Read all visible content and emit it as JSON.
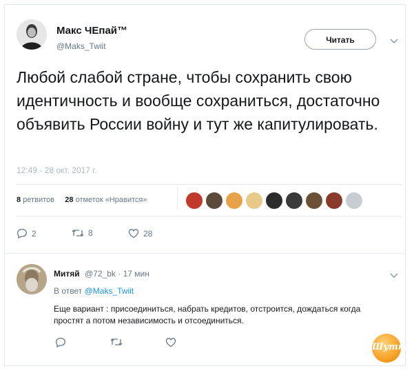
{
  "tweet": {
    "author_name": "Макс ЧЕпай™",
    "author_handle": "@Maks_Twiit",
    "follow_label": "Читать",
    "text": "Любой слабой стране, чтобы сохранить свою идентичность и вообще сохраниться, достаточно объявить России войну и тут же капитулировать.",
    "timestamp": "12:49 - 28 окт. 2017 г.",
    "retweets_count": "8",
    "retweets_label": "ретвитов",
    "likes_count": "28",
    "likes_label": "отметок «Нравится»",
    "likers": [
      "#c0392b",
      "#5b4a3a",
      "#e8a24a",
      "#e9c98a",
      "#2c2c2c",
      "#3a3a3a",
      "#6b5037",
      "#8a3a2c",
      "#c7cdd2"
    ],
    "actions": {
      "reply_count": "2",
      "retweet_count": "8",
      "like_count": "28"
    }
  },
  "reply": {
    "author_name": "Митяй",
    "author_handle": "@72_bk",
    "age": "· 17 мин",
    "reply_to_prefix": "В ответ",
    "reply_to_handle": "@Maks_Twiit",
    "text": "Еще вариант : присоединиться, набрать кредитов, отстроится, дождаться когда простят а потом независимость и отсоединиться."
  },
  "watermark": "Шутка",
  "colors": {
    "accent": "#1b95e0",
    "muted": "#657786",
    "light": "#aab8c2"
  }
}
